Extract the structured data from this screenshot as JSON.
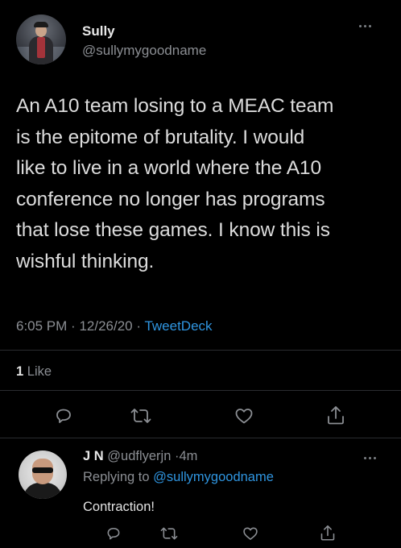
{
  "tweet": {
    "author_name": "Sully",
    "author_handle": "@sullymygoodname",
    "text": "An A10 team losing to a MEAC team\nis the epitome of brutality. I would\nlike to live in a world where the A10\nconference no longer has programs\nthat lose these games. I know this is\nwishful thinking.",
    "time": "6:05 PM",
    "date": "12/26/20",
    "source": "TweetDeck",
    "like_count": "1",
    "like_label": "Like",
    "icons": [
      "reply-icon",
      "retweet-icon",
      "like-icon",
      "share-icon",
      "more-icon"
    ]
  },
  "reply": {
    "author_name": "J N",
    "author_handle": "@udflyerjn",
    "age": "4m",
    "replying_prefix": "Replying to",
    "replying_to": "@sullymygoodname",
    "text": "Contraction!"
  },
  "colors": {
    "background": "#000000",
    "accent": "#2f95e0",
    "secondary_text": "#8b8e93"
  }
}
